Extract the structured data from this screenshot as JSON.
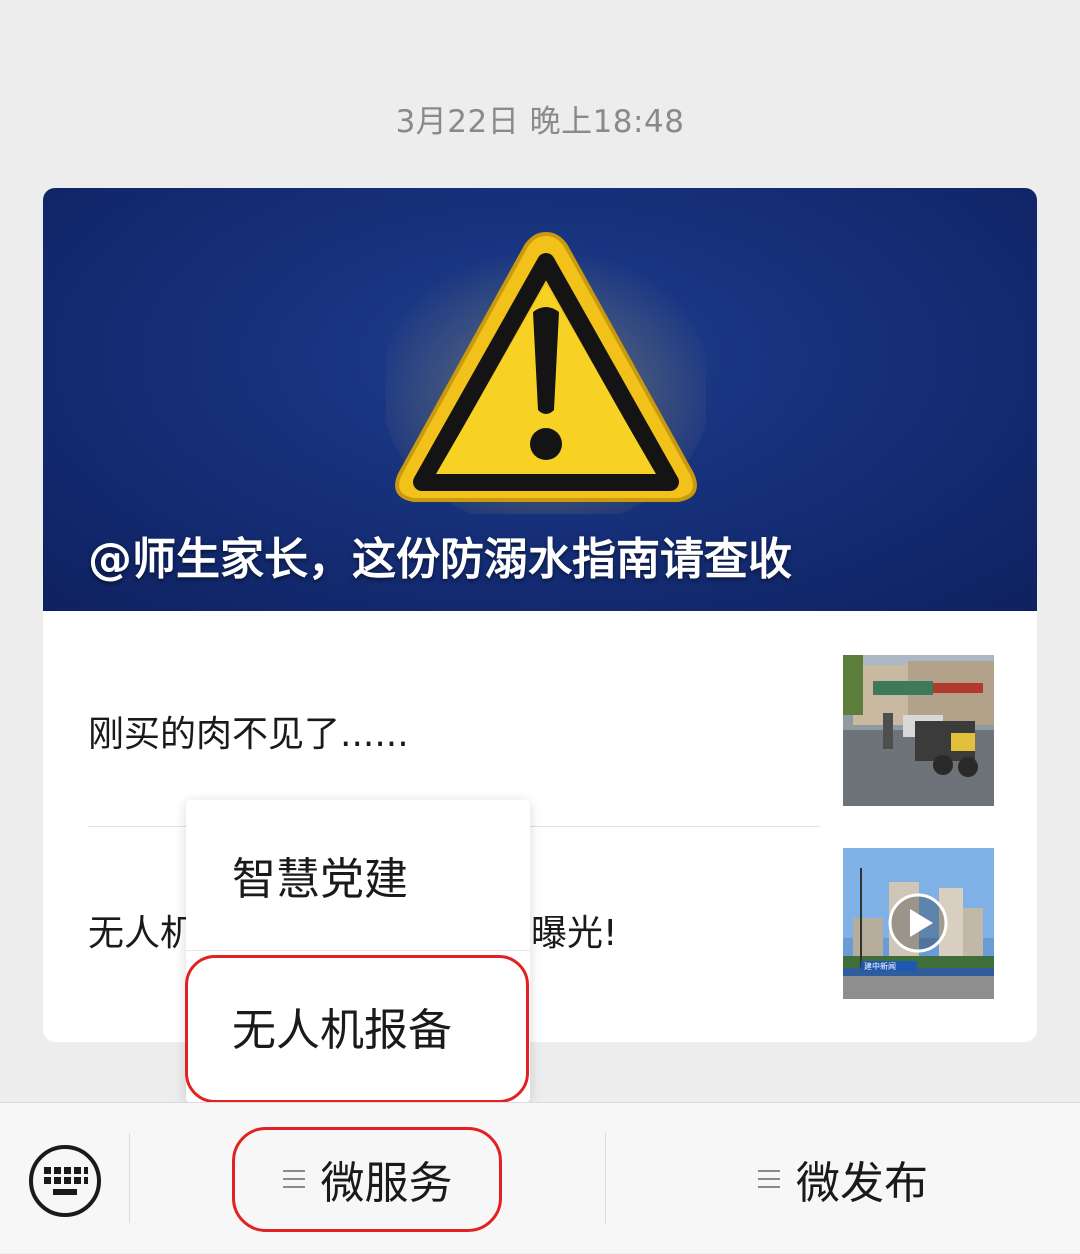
{
  "timestamp": "3月22日 晚上18:48",
  "hero": {
    "title": "@师生家长，这份防溺水指南请查收",
    "icon": "warning-triangle-icon",
    "colors": {
      "background": "#16307a",
      "warning": "#f5c518"
    }
  },
  "articles": [
    {
      "title": "刚买的肉不见了......",
      "thumbnail": "street-photo"
    },
    {
      "title_left": "无人机",
      "title_right": "曝光!",
      "thumbnail": "video-thumbnail",
      "thumbnail_caption": "建中新闻",
      "play_icon": "play-icon"
    }
  ],
  "popup_menu": {
    "items": [
      {
        "label": "智慧党建"
      },
      {
        "label": "无人机报备"
      }
    ]
  },
  "bottom_bar": {
    "keyboard_icon": "keyboard-icon",
    "menus": [
      {
        "label": "微服务",
        "icon": "menu-lines-icon"
      },
      {
        "label": "微发布",
        "icon": "menu-lines-icon"
      }
    ]
  },
  "highlight_color": "#e22222"
}
